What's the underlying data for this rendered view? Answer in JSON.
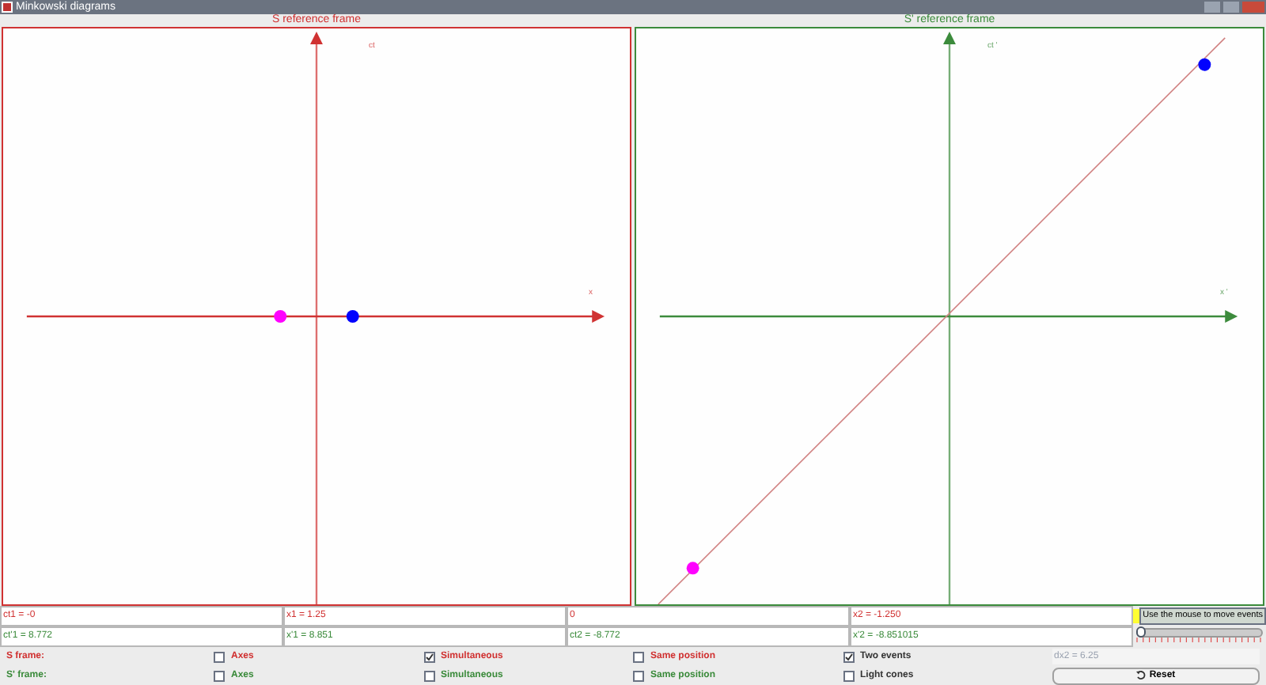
{
  "window": {
    "title": "Minkowski diagrams"
  },
  "panels": [
    {
      "title": "S reference frame",
      "kind": "rest",
      "axis_labels": [
        "ct",
        "x"
      ],
      "color": "#d03030"
    },
    {
      "title": "S' reference frame",
      "kind": "moving",
      "axis_labels": [
        "ct '",
        "x '"
      ],
      "color": "#3a8a3a"
    }
  ],
  "events": [
    {
      "color": "#ff00ff"
    },
    {
      "color": "#0000ff"
    }
  ],
  "fields": [
    [
      {
        "value": "ct1 = -0"
      },
      {
        "value": "x1 = 1.25"
      },
      {
        "value": "0"
      },
      {
        "value": "x2 = -1.250"
      }
    ],
    [
      {
        "value": "ct'1 = 8.772"
      },
      {
        "value": "x'1 = 8.851"
      },
      {
        "value": "ct2 = -8.772"
      },
      {
        "value": "x'2 = -8.851015"
      }
    ]
  ],
  "hint": "Use the mouse to move events",
  "slider": {
    "level": 0
  },
  "frames": [
    {
      "label": "S frame:",
      "color": "#d03030",
      "options": [
        {
          "label": "Axes",
          "checked": false
        },
        {
          "label": "Simultaneous",
          "checked": true
        },
        {
          "label": "Same position",
          "checked": false
        }
      ]
    },
    {
      "label": "S' frame:",
      "color": "#3a8a3a",
      "options": [
        {
          "label": "Axes",
          "checked": false
        },
        {
          "label": "Simultaneous",
          "checked": false
        },
        {
          "label": "Same position",
          "checked": false
        }
      ]
    }
  ],
  "extras": [
    {
      "label": "Two events",
      "checked": true
    },
    {
      "label": "Light cones",
      "checked": false
    }
  ],
  "dx_field": {
    "value": "dx2 = 6.25",
    "disabled": true
  },
  "reset_button": {
    "label": "Reset"
  }
}
